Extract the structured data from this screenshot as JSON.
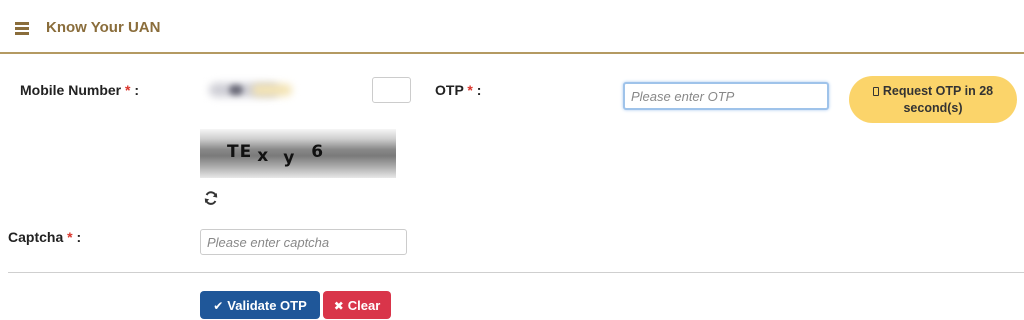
{
  "header": {
    "menu_icon": "hamburger-menu-icon",
    "title": "Know Your UAN"
  },
  "form": {
    "mobile_label": "Mobile Number",
    "otp_label": "OTP",
    "captcha_label": "Captcha",
    "required_mark": "*",
    "label_suffix": " :",
    "otp_placeholder": "Please enter OTP",
    "captcha_placeholder": "Please enter captcha",
    "captcha_chars": [
      "TE",
      "x",
      "y",
      "6"
    ],
    "refresh_icon": "refresh-icon"
  },
  "buttons": {
    "request_otp": "Request OTP in 28 second(s)",
    "validate": "Validate OTP",
    "clear": "Clear"
  },
  "colors": {
    "accent": "#8a6d3b",
    "request_button": "#fbd46a",
    "validate_button": "#1f5799",
    "clear_button": "#d9354a",
    "required": "#d9342b"
  }
}
